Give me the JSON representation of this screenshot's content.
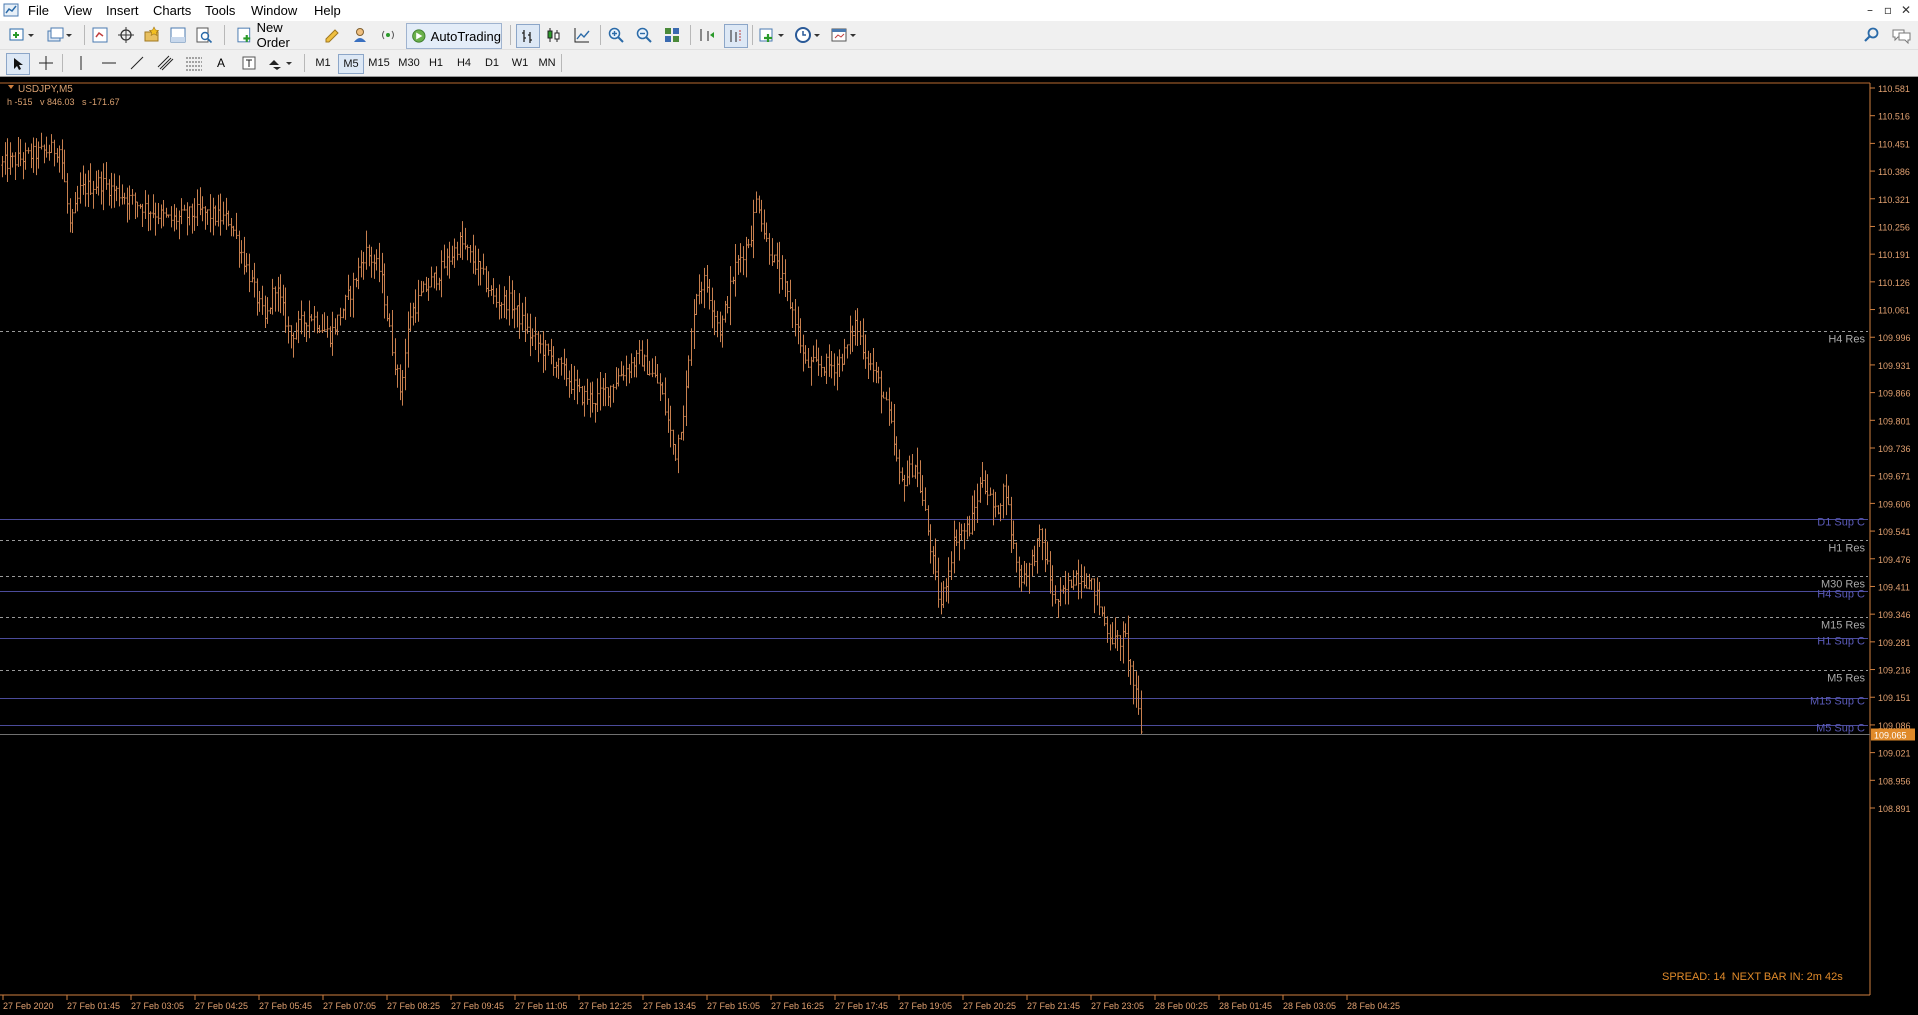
{
  "menubar": {
    "items": [
      "File",
      "View",
      "Insert",
      "Charts",
      "Tools",
      "Window",
      "Help"
    ]
  },
  "toolbar": {
    "new_order_label": "New Order",
    "autotrading_label": "AutoTrading"
  },
  "timeframes": [
    "M1",
    "M5",
    "M15",
    "M30",
    "H1",
    "H4",
    "D1",
    "W1",
    "MN"
  ],
  "active_timeframe": "M5",
  "chart": {
    "symbol_label": "USDJPY,M5",
    "info_line": "h -515   v 846.03   s -171.67",
    "status_text": "SPREAD: 14  NEXT BAR IN: 2m 42s",
    "current_price": "109.065",
    "colors": {
      "background": "#000000",
      "bars": "#c8804f",
      "axis": "#d08040",
      "res_line": "#9a9a9a",
      "sup_line": "#4b4b9a",
      "status": "#e08a2a"
    }
  },
  "chart_data": {
    "type": "bar",
    "title": "USDJPY,M5",
    "y_ticks": [
      "110.581",
      "110.516",
      "110.451",
      "110.386",
      "110.321",
      "110.256",
      "110.191",
      "110.126",
      "110.061",
      "109.996",
      "109.931",
      "109.866",
      "109.801",
      "109.736",
      "109.671",
      "109.606",
      "109.541",
      "109.476",
      "109.411",
      "109.346",
      "109.281",
      "109.216",
      "109.151",
      "109.086",
      "109.021",
      "108.956",
      "108.891"
    ],
    "ylim": [
      108.891,
      110.581
    ],
    "x_ticks": [
      "27 Feb 2020",
      "27 Feb 01:45",
      "27 Feb 03:05",
      "27 Feb 04:25",
      "27 Feb 05:45",
      "27 Feb 07:05",
      "27 Feb 08:25",
      "27 Feb 09:45",
      "27 Feb 11:05",
      "27 Feb 12:25",
      "27 Feb 13:45",
      "27 Feb 15:05",
      "27 Feb 16:25",
      "27 Feb 17:45",
      "27 Feb 19:05",
      "27 Feb 20:25",
      "27 Feb 21:45",
      "27 Feb 23:05",
      "28 Feb 00:25",
      "28 Feb 01:45",
      "28 Feb 03:05",
      "28 Feb 04:25"
    ],
    "price_path": [
      [
        0,
        110.4
      ],
      [
        40,
        110.43
      ],
      [
        60,
        110.44
      ],
      [
        70,
        110.25
      ],
      [
        80,
        110.34
      ],
      [
        100,
        110.36
      ],
      [
        130,
        110.32
      ],
      [
        170,
        110.27
      ],
      [
        200,
        110.29
      ],
      [
        230,
        110.27
      ],
      [
        245,
        110.17
      ],
      [
        265,
        110.03
      ],
      [
        275,
        110.12
      ],
      [
        290,
        110.0
      ],
      [
        310,
        110.05
      ],
      [
        330,
        110.0
      ],
      [
        350,
        110.1
      ],
      [
        365,
        110.2
      ],
      [
        380,
        110.15
      ],
      [
        390,
        110.0
      ],
      [
        400,
        109.87
      ],
      [
        410,
        110.05
      ],
      [
        425,
        110.11
      ],
      [
        440,
        110.15
      ],
      [
        460,
        110.22
      ],
      [
        480,
        110.15
      ],
      [
        495,
        110.08
      ],
      [
        510,
        110.08
      ],
      [
        530,
        110.0
      ],
      [
        550,
        109.95
      ],
      [
        565,
        109.91
      ],
      [
        580,
        109.86
      ],
      [
        595,
        109.85
      ],
      [
        610,
        109.88
      ],
      [
        620,
        109.91
      ],
      [
        640,
        109.95
      ],
      [
        660,
        109.88
      ],
      [
        675,
        109.72
      ],
      [
        685,
        109.85
      ],
      [
        695,
        110.1
      ],
      [
        705,
        110.13
      ],
      [
        720,
        110.01
      ],
      [
        735,
        110.16
      ],
      [
        750,
        110.23
      ],
      [
        757,
        110.33
      ],
      [
        765,
        110.23
      ],
      [
        780,
        110.14
      ],
      [
        795,
        110.04
      ],
      [
        805,
        109.93
      ],
      [
        820,
        109.93
      ],
      [
        835,
        109.93
      ],
      [
        845,
        109.96
      ],
      [
        855,
        110.03
      ],
      [
        865,
        109.96
      ],
      [
        880,
        109.88
      ],
      [
        890,
        109.8
      ],
      [
        900,
        109.65
      ],
      [
        915,
        109.7
      ],
      [
        925,
        109.58
      ],
      [
        940,
        109.36
      ],
      [
        955,
        109.53
      ],
      [
        970,
        109.55
      ],
      [
        982,
        109.67
      ],
      [
        995,
        109.58
      ],
      [
        1005,
        109.65
      ],
      [
        1012,
        109.52
      ],
      [
        1020,
        109.43
      ],
      [
        1030,
        109.46
      ],
      [
        1040,
        109.53
      ],
      [
        1048,
        109.45
      ],
      [
        1055,
        109.37
      ],
      [
        1065,
        109.4
      ],
      [
        1075,
        109.44
      ],
      [
        1085,
        109.43
      ],
      [
        1095,
        109.4
      ],
      [
        1105,
        109.32
      ],
      [
        1115,
        109.28
      ],
      [
        1125,
        109.29
      ],
      [
        1130,
        109.22
      ],
      [
        1135,
        109.16
      ],
      [
        1142,
        109.06
      ]
    ],
    "levels": [
      {
        "name": "H4 Res",
        "price": 110.01,
        "kind": "res"
      },
      {
        "name": "D1 Sup C",
        "price": 109.57,
        "kind": "sup"
      },
      {
        "name": "H1 Res",
        "price": 109.52,
        "kind": "res"
      },
      {
        "name": "M30 Res",
        "price": 109.435,
        "kind": "res"
      },
      {
        "name": "H4 Sup C",
        "price": 109.4,
        "kind": "sup"
      },
      {
        "name": "M15 Res",
        "price": 109.34,
        "kind": "res"
      },
      {
        "name": "H1 Sup C",
        "price": 109.29,
        "kind": "sup"
      },
      {
        "name": "M5 Res",
        "price": 109.215,
        "kind": "res"
      },
      {
        "name": "M15 Sup C",
        "price": 109.15,
        "kind": "sup"
      },
      {
        "name": "M5 Sup C",
        "price": 109.085,
        "kind": "sup"
      }
    ]
  }
}
